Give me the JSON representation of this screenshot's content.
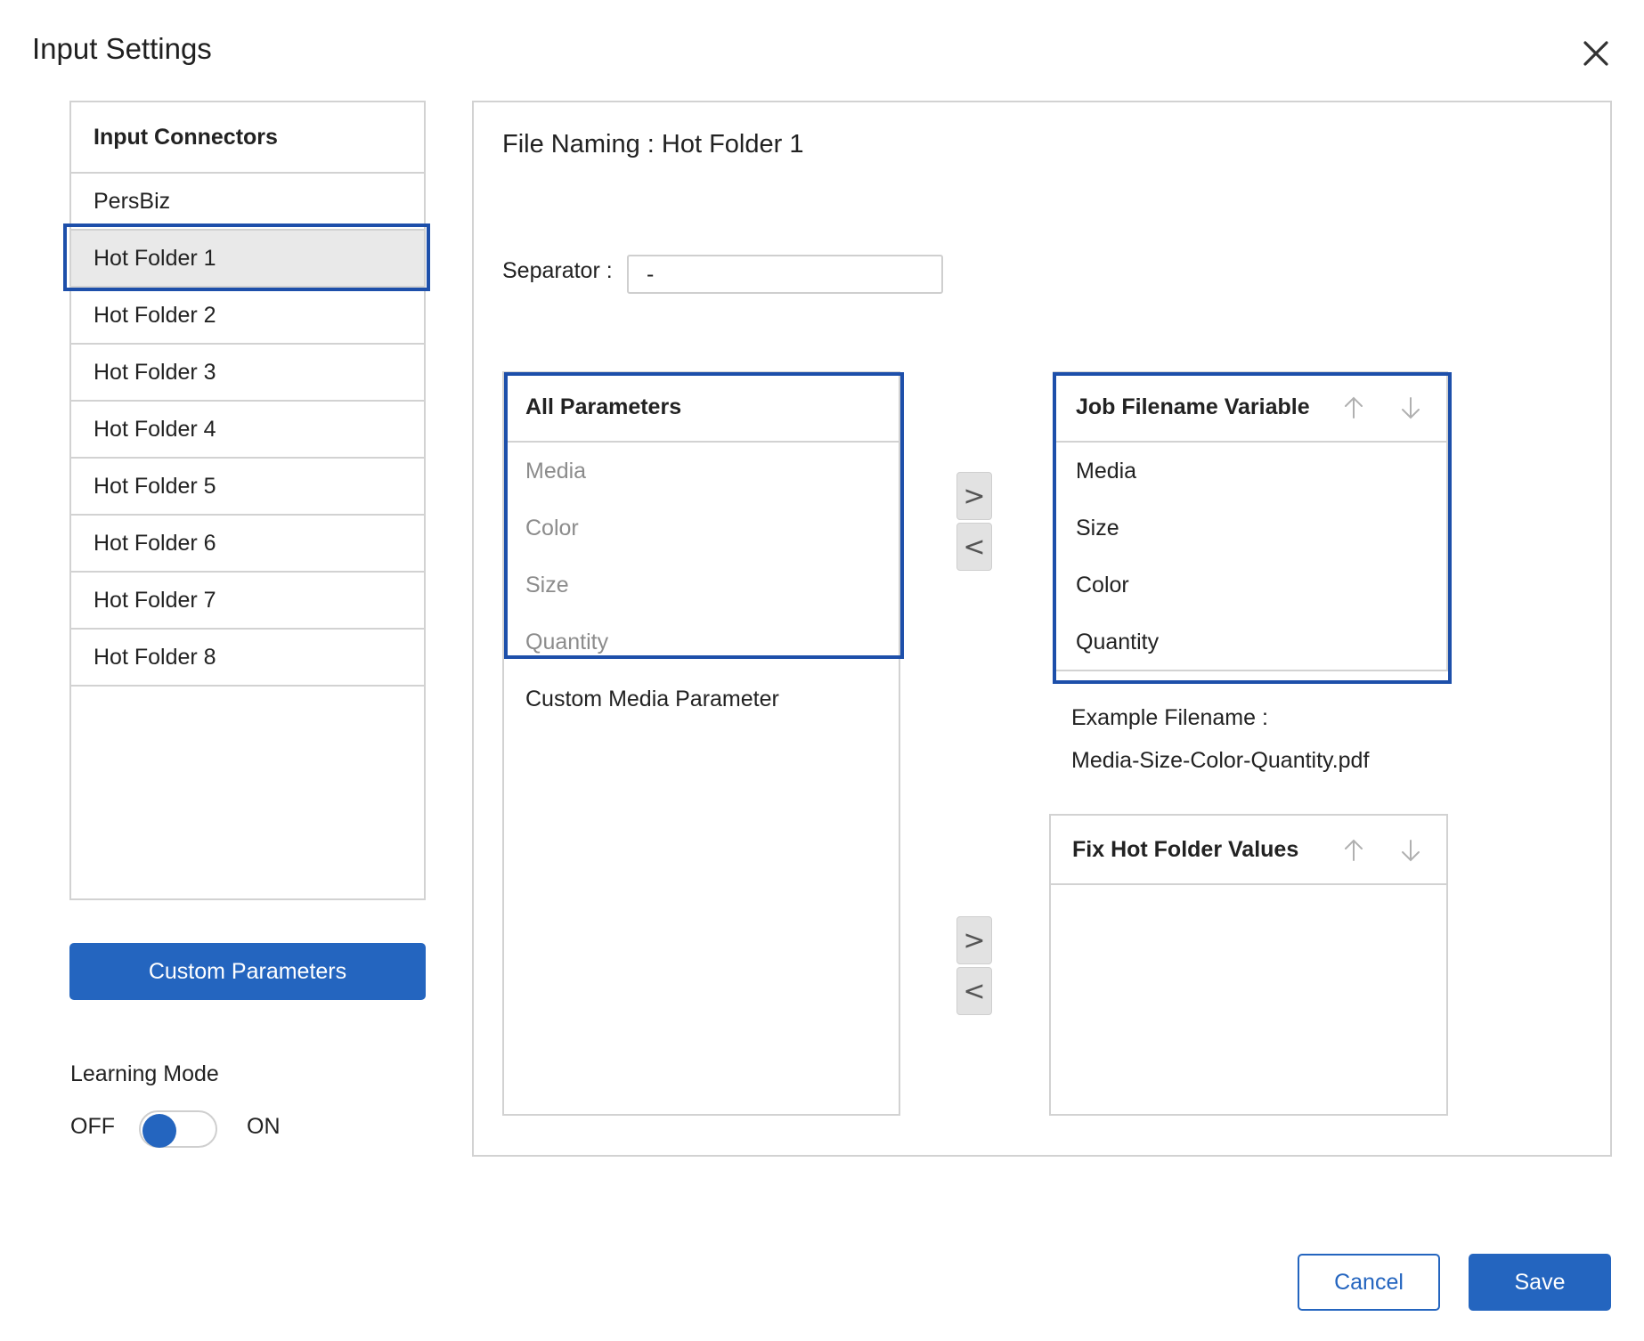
{
  "dialog": {
    "title": "Input Settings",
    "close_icon": "close-icon"
  },
  "connectors": {
    "header": "Input Connectors",
    "items": [
      "PersBiz",
      "Hot Folder 1",
      "Hot Folder 2",
      "Hot Folder 3",
      "Hot Folder 4",
      "Hot Folder 5",
      "Hot Folder 6",
      "Hot Folder 7",
      "Hot Folder 8"
    ],
    "selected": "Hot Folder 1"
  },
  "custom_parameters_label": "Custom Parameters",
  "learning_mode": {
    "label": "Learning Mode",
    "off_label": "OFF",
    "on_label": "ON",
    "state": "off"
  },
  "main": {
    "title": "File Naming : Hot Folder 1",
    "separator_label": "Separator :",
    "separator_value": "-"
  },
  "all_parameters": {
    "header": "All Parameters",
    "items": [
      "Media",
      "Color",
      "Size",
      "Quantity",
      "Custom Media Parameter"
    ]
  },
  "transfer": {
    "add_symbol": ">",
    "remove_symbol": "<"
  },
  "job_filename_variable": {
    "header": "Job Filename Variable",
    "items": [
      "Media",
      "Size",
      "Color",
      "Quantity"
    ],
    "move_up_icon": "arrow-up-icon",
    "move_down_icon": "arrow-down-icon"
  },
  "example": {
    "label": "Example Filename :",
    "value": "Media-Size-Color-Quantity.pdf"
  },
  "fix_hot_folder_values": {
    "header": "Fix Hot Folder Values",
    "items": []
  },
  "footer": {
    "cancel_label": "Cancel",
    "save_label": "Save"
  },
  "colors": {
    "accent": "#2465bf",
    "selection_outline": "#1d4faa",
    "selected_row": "#e9e9e9",
    "border": "#d2d2d2",
    "dim_text": "#8c8c8c"
  }
}
